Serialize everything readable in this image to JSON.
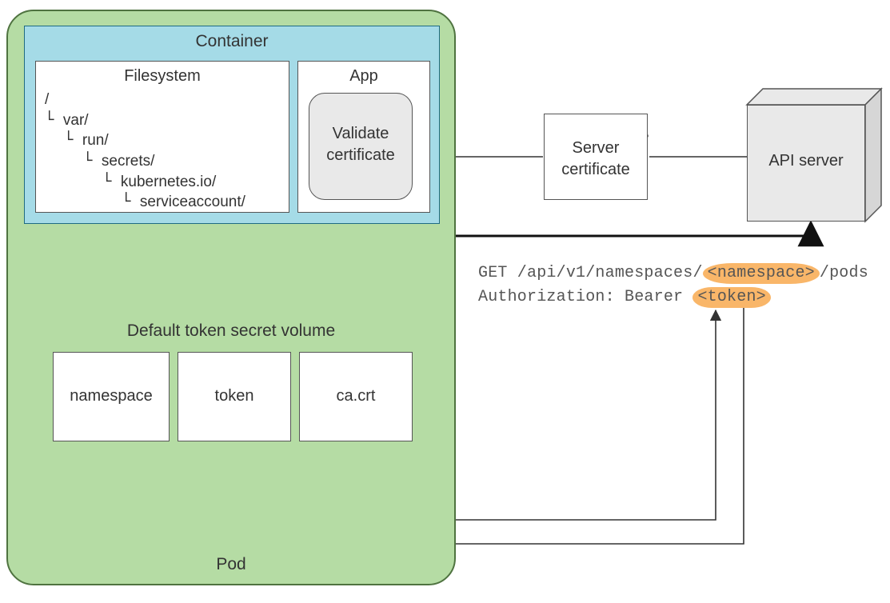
{
  "pod": {
    "label": "Pod"
  },
  "container": {
    "label": "Container"
  },
  "filesystem": {
    "label": "Filesystem",
    "tree": {
      "root": "/",
      "l1": "var/",
      "l2": "run/",
      "l3": "secrets/",
      "l4": "kubernetes.io/",
      "l5": "serviceaccount/"
    }
  },
  "app": {
    "label": "App",
    "validate1": "Validate",
    "validate2": "certificate"
  },
  "volume": {
    "label": "Default token secret volume",
    "files": {
      "namespace": "namespace",
      "token": "token",
      "cacrt": "ca.crt"
    }
  },
  "server_cert": {
    "line1": "Server",
    "line2": "certificate"
  },
  "api_server": {
    "label": "API server"
  },
  "request": {
    "line1_pre": "GET /api/v1/namespaces/",
    "line1_ns": "<namespace>",
    "line1_post": "/pods",
    "line2_pre": "Authorization: Bearer ",
    "line2_tok": "<token>"
  }
}
